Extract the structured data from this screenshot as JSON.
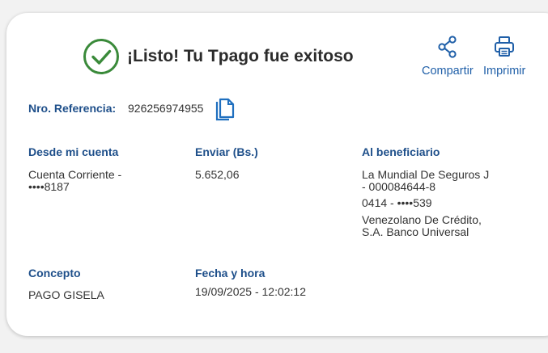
{
  "header": {
    "title": "¡Listo! Tu Tpago fue exitoso",
    "success_color": "#3a8a3a",
    "share_label": "Compartir",
    "print_label": "Imprimir",
    "accent_color": "#1f5fa8"
  },
  "reference": {
    "label": "Nro. Referencia:",
    "value": "926256974955"
  },
  "details": {
    "from": {
      "label": "Desde mi cuenta",
      "line1": "Cuenta Corriente -",
      "line2": "••••8187"
    },
    "amount": {
      "label": "Enviar (Bs.)",
      "value": "5.652,06"
    },
    "beneficiary": {
      "label": "Al beneficiario",
      "name_line1": "La Mundial De Seguros J",
      "name_line2": "- 000084644-8",
      "phone": "0414 - ••••539",
      "bank_line1": "Venezolano De Crédito,",
      "bank_line2": "S.A. Banco Universal"
    },
    "concept": {
      "label": "Concepto",
      "value": "PAGO GISELA"
    },
    "datetime": {
      "label": "Fecha y hora",
      "value": "19/09/2025 - 12:02:12"
    }
  }
}
